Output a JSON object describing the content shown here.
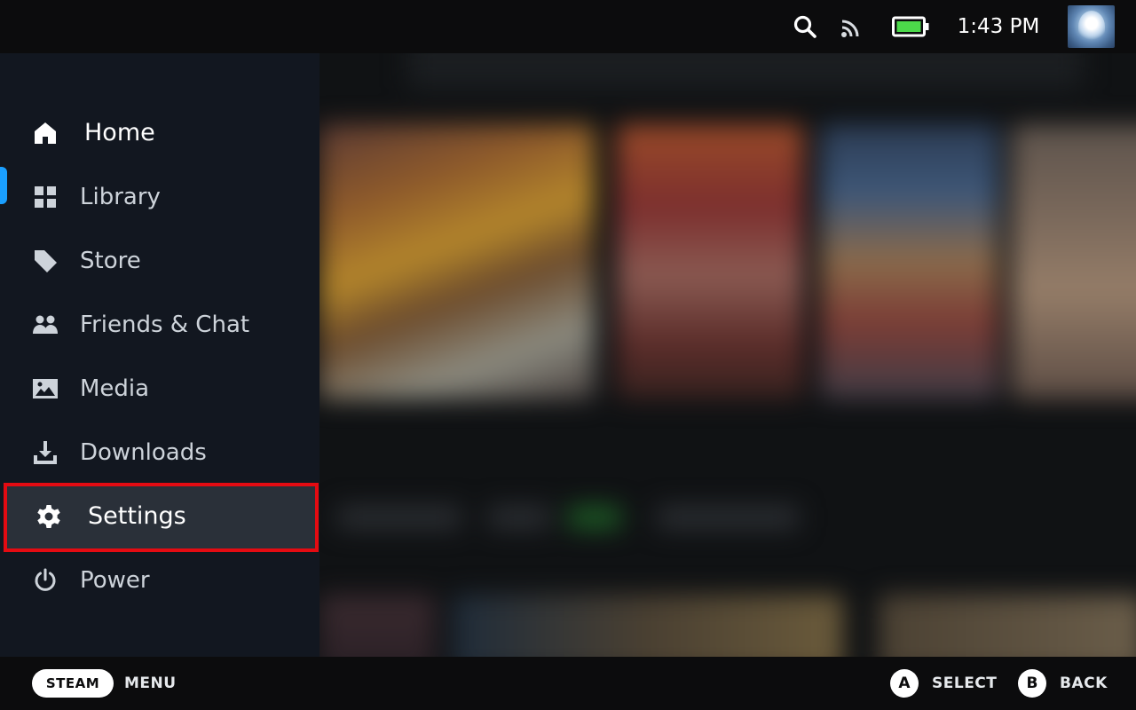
{
  "status_bar": {
    "search_icon": "search-icon",
    "cast_icon": "cast-icon",
    "battery_icon": "battery-icon",
    "battery_color": "#4cd94a",
    "clock": "1:43 PM",
    "avatar_icon": "user-avatar"
  },
  "sidebar": {
    "accent_color": "#1a9fff",
    "items": [
      {
        "label": "Home",
        "icon": "home-icon"
      },
      {
        "label": "Library",
        "icon": "grid-icon"
      },
      {
        "label": "Store",
        "icon": "tag-icon"
      },
      {
        "label": "Friends & Chat",
        "icon": "friends-icon"
      },
      {
        "label": "Media",
        "icon": "image-icon"
      },
      {
        "label": "Downloads",
        "icon": "download-icon"
      },
      {
        "label": "Settings",
        "icon": "gear-icon"
      },
      {
        "label": "Power",
        "icon": "power-icon"
      }
    ],
    "active_item": "Home",
    "highlighted_item": "Settings",
    "highlight_color": "#e40b12"
  },
  "bottom_bar": {
    "steam_label": "STEAM",
    "menu_label": "MENU",
    "a_button": "A",
    "select_label": "SELECT",
    "b_button": "B",
    "back_label": "BACK"
  }
}
